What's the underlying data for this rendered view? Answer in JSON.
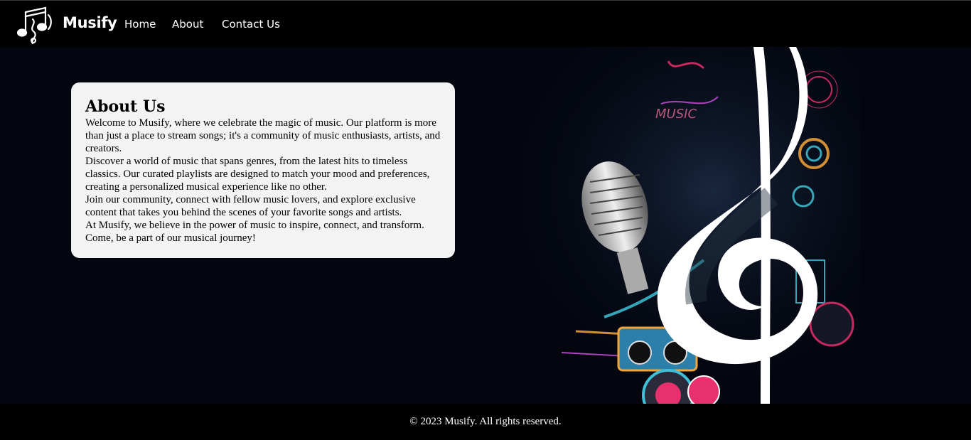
{
  "nav": {
    "brand": "Musify",
    "links": [
      "Home",
      "About",
      "Contact Us"
    ]
  },
  "about": {
    "title": "About Us",
    "paragraphs": [
      "Welcome to Musify, where we celebrate the magic of music. Our platform is more than just a place to stream songs; it's a community of music enthusiasts, artists, and creators.",
      "Discover a world of music that spans genres, from the latest hits to timeless classics. Our curated playlists are designed to match your mood and preferences, creating a personalized musical experience like no other.",
      "Join our community, connect with fellow music lovers, and explore exclusive content that takes you behind the scenes of your favorite songs and artists.",
      "At Musify, we believe in the power of music to inspire, connect, and transform. Come, be a part of our musical journey!"
    ]
  },
  "hero_art": {
    "text": "MUSIC",
    "icons": [
      "treble-clef-icon",
      "microphone-icon",
      "boombox-icon",
      "speaker-icon"
    ]
  },
  "footer": {
    "text": "© 2023 Musify. All rights reserved."
  },
  "colors": {
    "nav_bg": "#000000",
    "hero_bg": "#03060f",
    "card_bg": "#f3f3f3",
    "accent_pink": "#e8306f",
    "accent_cyan": "#3fc0d6"
  }
}
